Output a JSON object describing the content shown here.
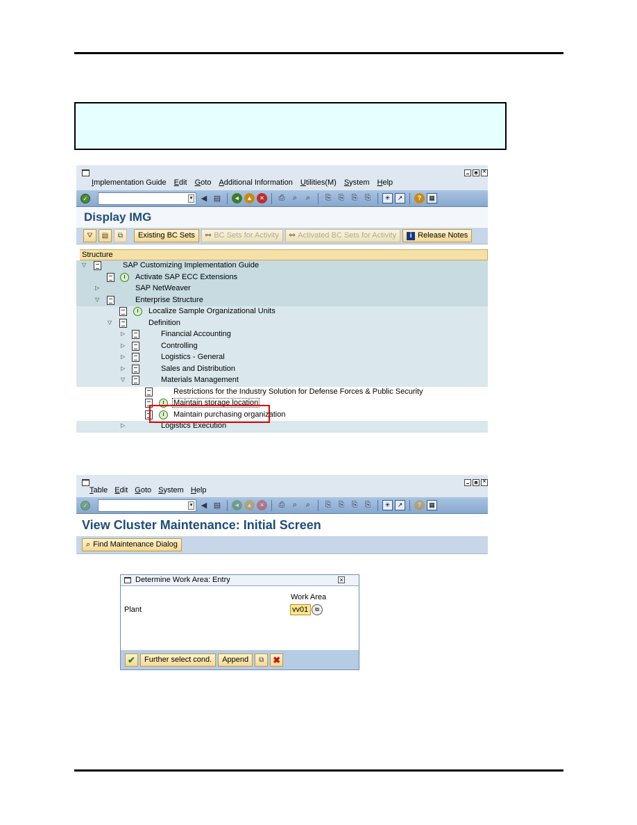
{
  "screen1": {
    "menu": [
      "Implementation Guide",
      "Edit",
      "Goto",
      "Additional Information",
      "Utilities(M)",
      "System",
      "Help"
    ],
    "title": "Display IMG",
    "buttons": {
      "existing_bc_sets": "Existing BC Sets",
      "bc_sets_for_activity": "BC Sets for Activity",
      "activated_bc_sets": "Activated BC Sets for Activity",
      "release_notes": "Release Notes"
    },
    "tree_header": "Structure",
    "tree": [
      {
        "label": "SAP Customizing Implementation Guide"
      },
      {
        "label": "Activate SAP ECC Extensions"
      },
      {
        "label": "SAP NetWeaver"
      },
      {
        "label": "Enterprise Structure"
      },
      {
        "label": "Localize Sample Organizational Units"
      },
      {
        "label": "Definition"
      },
      {
        "label": "Financial Accounting"
      },
      {
        "label": "Controlling"
      },
      {
        "label": "Logistics - General"
      },
      {
        "label": "Sales and Distribution"
      },
      {
        "label": "Materials Management"
      },
      {
        "label": "Restrictions for the Industry Solution for Defense Forces & Public Security"
      },
      {
        "label": "Maintain storage location"
      },
      {
        "label": "Maintain purchasing organization"
      },
      {
        "label": "Logistics Execution"
      }
    ]
  },
  "screen2": {
    "menu": [
      "Table",
      "Edit",
      "Goto",
      "System",
      "Help"
    ],
    "title": "View Cluster Maintenance: Initial Screen",
    "find_button": "Find Maintenance Dialog",
    "dialog": {
      "title": "Determine Work Area: Entry",
      "column_header": "Work Area",
      "field_label": "Plant",
      "field_value": "vv01",
      "buttons": {
        "further_select": "Further select cond.",
        "append": "Append"
      }
    }
  }
}
